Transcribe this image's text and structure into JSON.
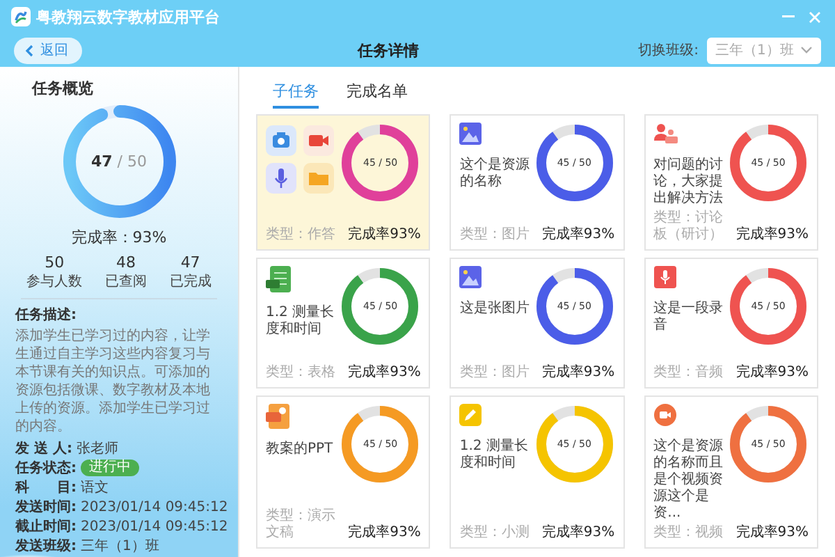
{
  "app": {
    "title": "粤教翔云数字教材应用平台"
  },
  "nav": {
    "back": "返回",
    "title": "任务详情",
    "class_label": "切换班级:",
    "class_value": "三年（1）班"
  },
  "overview": {
    "title": "任务概览",
    "done": "47",
    "total": "/ 50",
    "level": 0.94,
    "rate": "完成率：93%",
    "stats": [
      {
        "value": "50",
        "label": "参与人数"
      },
      {
        "value": "48",
        "label": "已查阅"
      },
      {
        "value": "47",
        "label": "已完成"
      }
    ],
    "description_label": "任务描述:",
    "description": "添加学生已学习过的内容，让学生通过自主学习这些内容复习与本节课有关的知识点。可添加的资源包括微课、数字教材及本地上传的资源。添加学生已学习过的内容。",
    "fields": [
      {
        "label": "发 送 人:",
        "value": "张老师",
        "kind": "text"
      },
      {
        "label": "任务状态:",
        "value": "进行中",
        "kind": "badge"
      },
      {
        "label": "科　　目:",
        "value": "语文",
        "kind": "text"
      },
      {
        "label": "发送时间:",
        "value": "2023/01/14 09:45:12",
        "kind": "text"
      },
      {
        "label": "截止时间:",
        "value": "2023/01/14 09:45:12",
        "kind": "text"
      },
      {
        "label": "发送班级:",
        "value": "三年（1）班",
        "kind": "text"
      }
    ]
  },
  "tabs": [
    {
      "label": "子任务",
      "selected": true
    },
    {
      "label": "完成名单",
      "selected": false
    }
  ],
  "cards": [
    {
      "kind": "homework",
      "type": "类型：作答",
      "reading": "45 / 50",
      "rate": "完成率93%",
      "level": 0.9,
      "color": "#e0409a",
      "selected": true
    },
    {
      "kind": "image",
      "title": "这个是资源的名称",
      "type": "类型：图片",
      "reading": "45 / 50",
      "rate": "完成率93%",
      "level": 0.9,
      "color": "#4b5de8",
      "selected": false
    },
    {
      "kind": "discussion",
      "title": "对问题的讨论，大家提出解决方法",
      "type": "类型：讨论板（研讨）",
      "reading": "45 / 50",
      "rate": "完成率93%",
      "level": 0.9,
      "color": "#ef5350",
      "selected": false
    },
    {
      "kind": "sheet",
      "title": "1.2  测量长度和时间",
      "type": "类型：表格",
      "reading": "45 / 50",
      "rate": "完成率93%",
      "level": 0.9,
      "color": "#3aa34a",
      "selected": false
    },
    {
      "kind": "image",
      "title": "这是张图片",
      "type": "类型：图片",
      "reading": "45 / 50",
      "rate": "完成率93%",
      "level": 0.9,
      "color": "#4b5de8",
      "selected": false
    },
    {
      "kind": "audio",
      "title": "这是一段录音",
      "type": "类型：音频",
      "reading": "45 / 50",
      "rate": "完成率93%",
      "level": 0.9,
      "color": "#ef5350",
      "selected": false
    },
    {
      "kind": "ppt",
      "title": "教案的PPT",
      "type": "类型：演示文稿",
      "reading": "45 / 50",
      "rate": "完成率93%",
      "level": 0.9,
      "color": "#f59a23",
      "selected": false
    },
    {
      "kind": "quiz",
      "title": "1.2  测量长度和时间",
      "type": "类型：小测",
      "reading": "45 / 50",
      "rate": "完成率93%",
      "level": 0.9,
      "color": "#f5c400",
      "selected": false
    },
    {
      "kind": "video",
      "title": "这个是资源的名称而且是个视频资源这个是资...",
      "type": "类型：视频",
      "reading": "45 / 50",
      "rate": "完成率93%",
      "level": 0.9,
      "color": "#ef7040",
      "selected": false
    }
  ]
}
